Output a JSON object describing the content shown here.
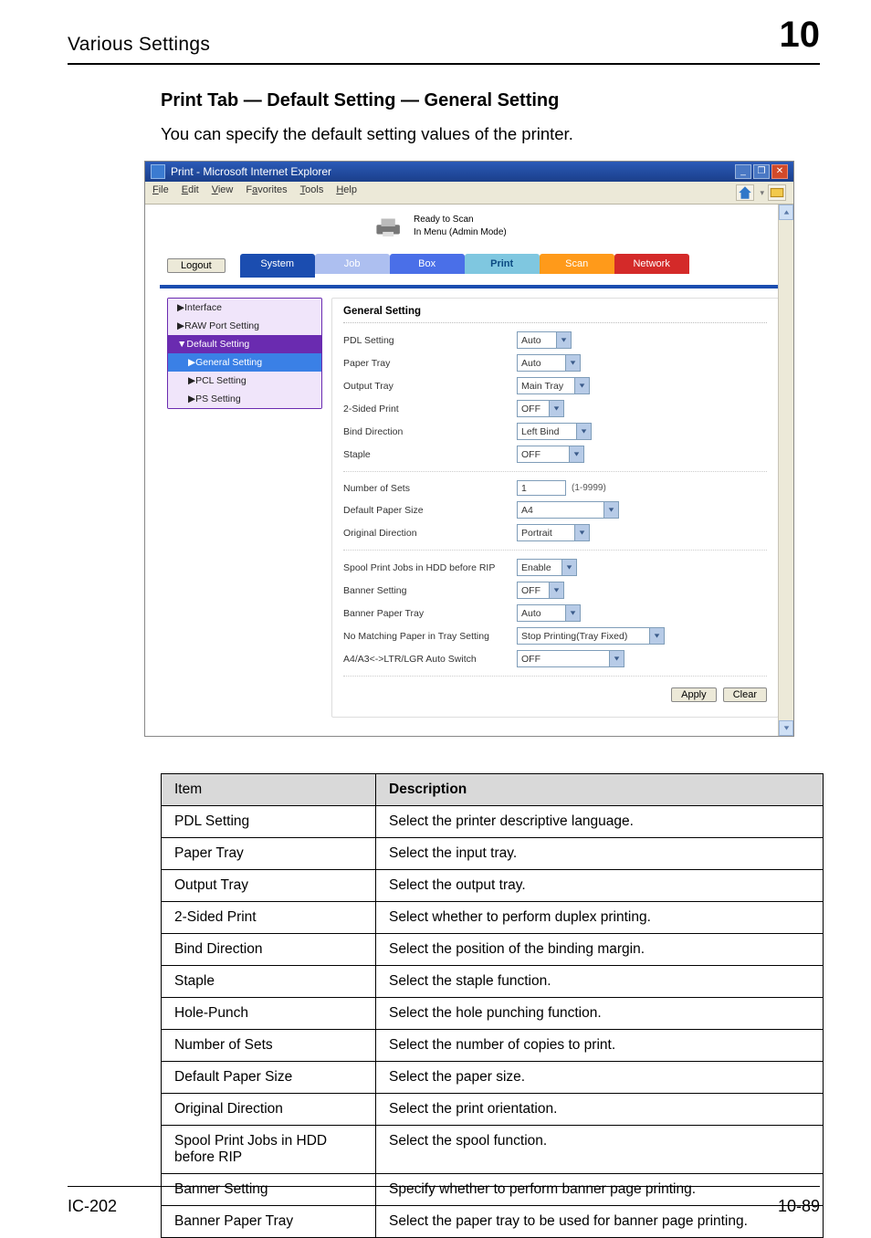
{
  "header": {
    "title": "Various Settings",
    "chapter": "10"
  },
  "section": {
    "subtitle": "Print Tab — Default Setting — General Setting",
    "lead": "You can specify the default setting values of the printer."
  },
  "screenshot": {
    "window_title": "Print - Microsoft Internet Explorer",
    "menu": {
      "file": "File",
      "edit": "Edit",
      "view": "View",
      "favorites": "Favorites",
      "tools": "Tools",
      "help": "Help"
    },
    "status": {
      "line1": "Ready to Scan",
      "line2": "In Menu (Admin Mode)"
    },
    "btn_logout": "Logout",
    "tabs": {
      "system": "System",
      "job": "Job",
      "box": "Box",
      "print": "Print",
      "scan": "Scan",
      "network": "Network"
    },
    "side": {
      "interface": "▶Interface",
      "raw_port": "▶RAW Port Setting",
      "default_setting": "▼Default Setting",
      "general_setting": "▶General Setting",
      "pcl_setting": "▶PCL Setting",
      "ps_setting": "▶PS Setting"
    },
    "main": {
      "title": "General Setting",
      "rows": {
        "pdl_setting": "PDL Setting",
        "paper_tray": "Paper Tray",
        "output_tray": "Output Tray",
        "two_sided": "2-Sided Print",
        "bind_dir": "Bind Direction",
        "staple": "Staple",
        "num_sets": "Number of Sets",
        "paper_size": "Default Paper Size",
        "orig_dir": "Original Direction",
        "spool": "Spool Print Jobs in HDD before RIP",
        "banner": "Banner Setting",
        "banner_tray": "Banner Paper Tray",
        "no_match": "No Matching Paper in Tray Setting",
        "a4a3": "A4/A3<->LTR/LGR Auto Switch"
      },
      "vals": {
        "pdl_setting": "Auto",
        "paper_tray": "Auto",
        "output_tray": "Main Tray",
        "two_sided": "OFF",
        "bind_dir": "Left Bind",
        "staple": "OFF",
        "num_sets": "1",
        "num_sets_range": "(1-9999)",
        "paper_size": "A4",
        "orig_dir": "Portrait",
        "spool": "Enable",
        "banner": "OFF",
        "banner_tray": "Auto",
        "no_match": "Stop Printing(Tray Fixed)",
        "a4a3": "OFF"
      },
      "btn_apply": "Apply",
      "btn_clear": "Clear"
    }
  },
  "table": {
    "head_item": "Item",
    "head_desc": "Description",
    "rows": [
      {
        "item": "PDL Setting",
        "desc": "Select the printer descriptive language."
      },
      {
        "item": "Paper Tray",
        "desc": "Select the input tray."
      },
      {
        "item": "Output Tray",
        "desc": "Select the output tray."
      },
      {
        "item": "2-Sided Print",
        "desc": "Select whether to perform duplex printing."
      },
      {
        "item": "Bind Direction",
        "desc": "Select the position of the binding margin."
      },
      {
        "item": "Staple",
        "desc": "Select the staple function."
      },
      {
        "item": "Hole-Punch",
        "desc": "Select the hole punching function."
      },
      {
        "item": "Number of Sets",
        "desc": "Select the number of copies to print."
      },
      {
        "item": "Default Paper Size",
        "desc": "Select the paper size."
      },
      {
        "item": "Original Direction",
        "desc": "Select the print orientation."
      },
      {
        "item": "Spool Print Jobs in HDD before RIP",
        "desc": "Select the spool function."
      },
      {
        "item": "Banner Setting",
        "desc": "Specify whether to perform banner page printing."
      },
      {
        "item": "Banner Paper Tray",
        "desc": "Select the paper tray to be used for banner page printing."
      }
    ]
  },
  "footer": {
    "left": "IC-202",
    "right": "10-89"
  }
}
